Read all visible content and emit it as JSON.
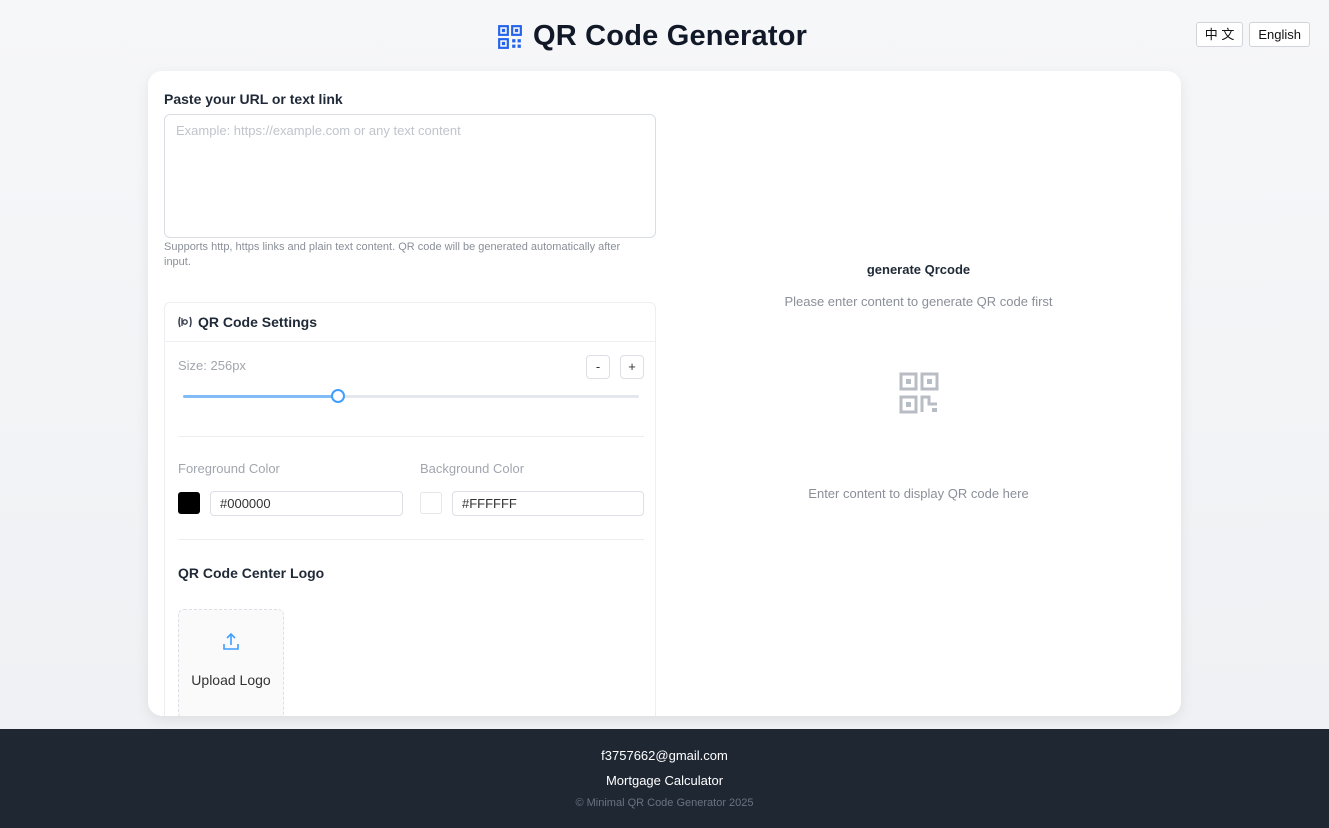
{
  "header": {
    "title": "QR Code Generator",
    "languages": [
      "中 文",
      "English"
    ]
  },
  "input": {
    "label": "Paste your URL or text link",
    "placeholder": "Example: https://example.com or any text content",
    "value": "",
    "hint": "Supports http, https links and plain text content. QR code will be generated automatically after input."
  },
  "settings": {
    "title": "QR Code Settings",
    "size_label": "Size: 256px",
    "size_value": 256,
    "size_fraction": 0.34,
    "decrement_label": "-",
    "increment_label": "+",
    "foreground": {
      "label": "Foreground Color",
      "value": "#000000",
      "color": "#000000"
    },
    "background": {
      "label": "Background Color",
      "value": "#FFFFFF",
      "color": "#FFFFFF"
    },
    "logo_title": "QR Code Center Logo",
    "upload_label": "Upload Logo"
  },
  "preview": {
    "title": "generate Qrcode",
    "subtitle": "Please enter content to generate QR code first",
    "empty_text": "Enter content to display QR code here"
  },
  "footer": {
    "email": "f3757662@gmail.com",
    "link": "Mortgage Calculator",
    "copyright": "© Minimal QR Code Generator 2025"
  },
  "colors": {
    "accent": "#409eff",
    "footer_bg": "#1f2733"
  }
}
